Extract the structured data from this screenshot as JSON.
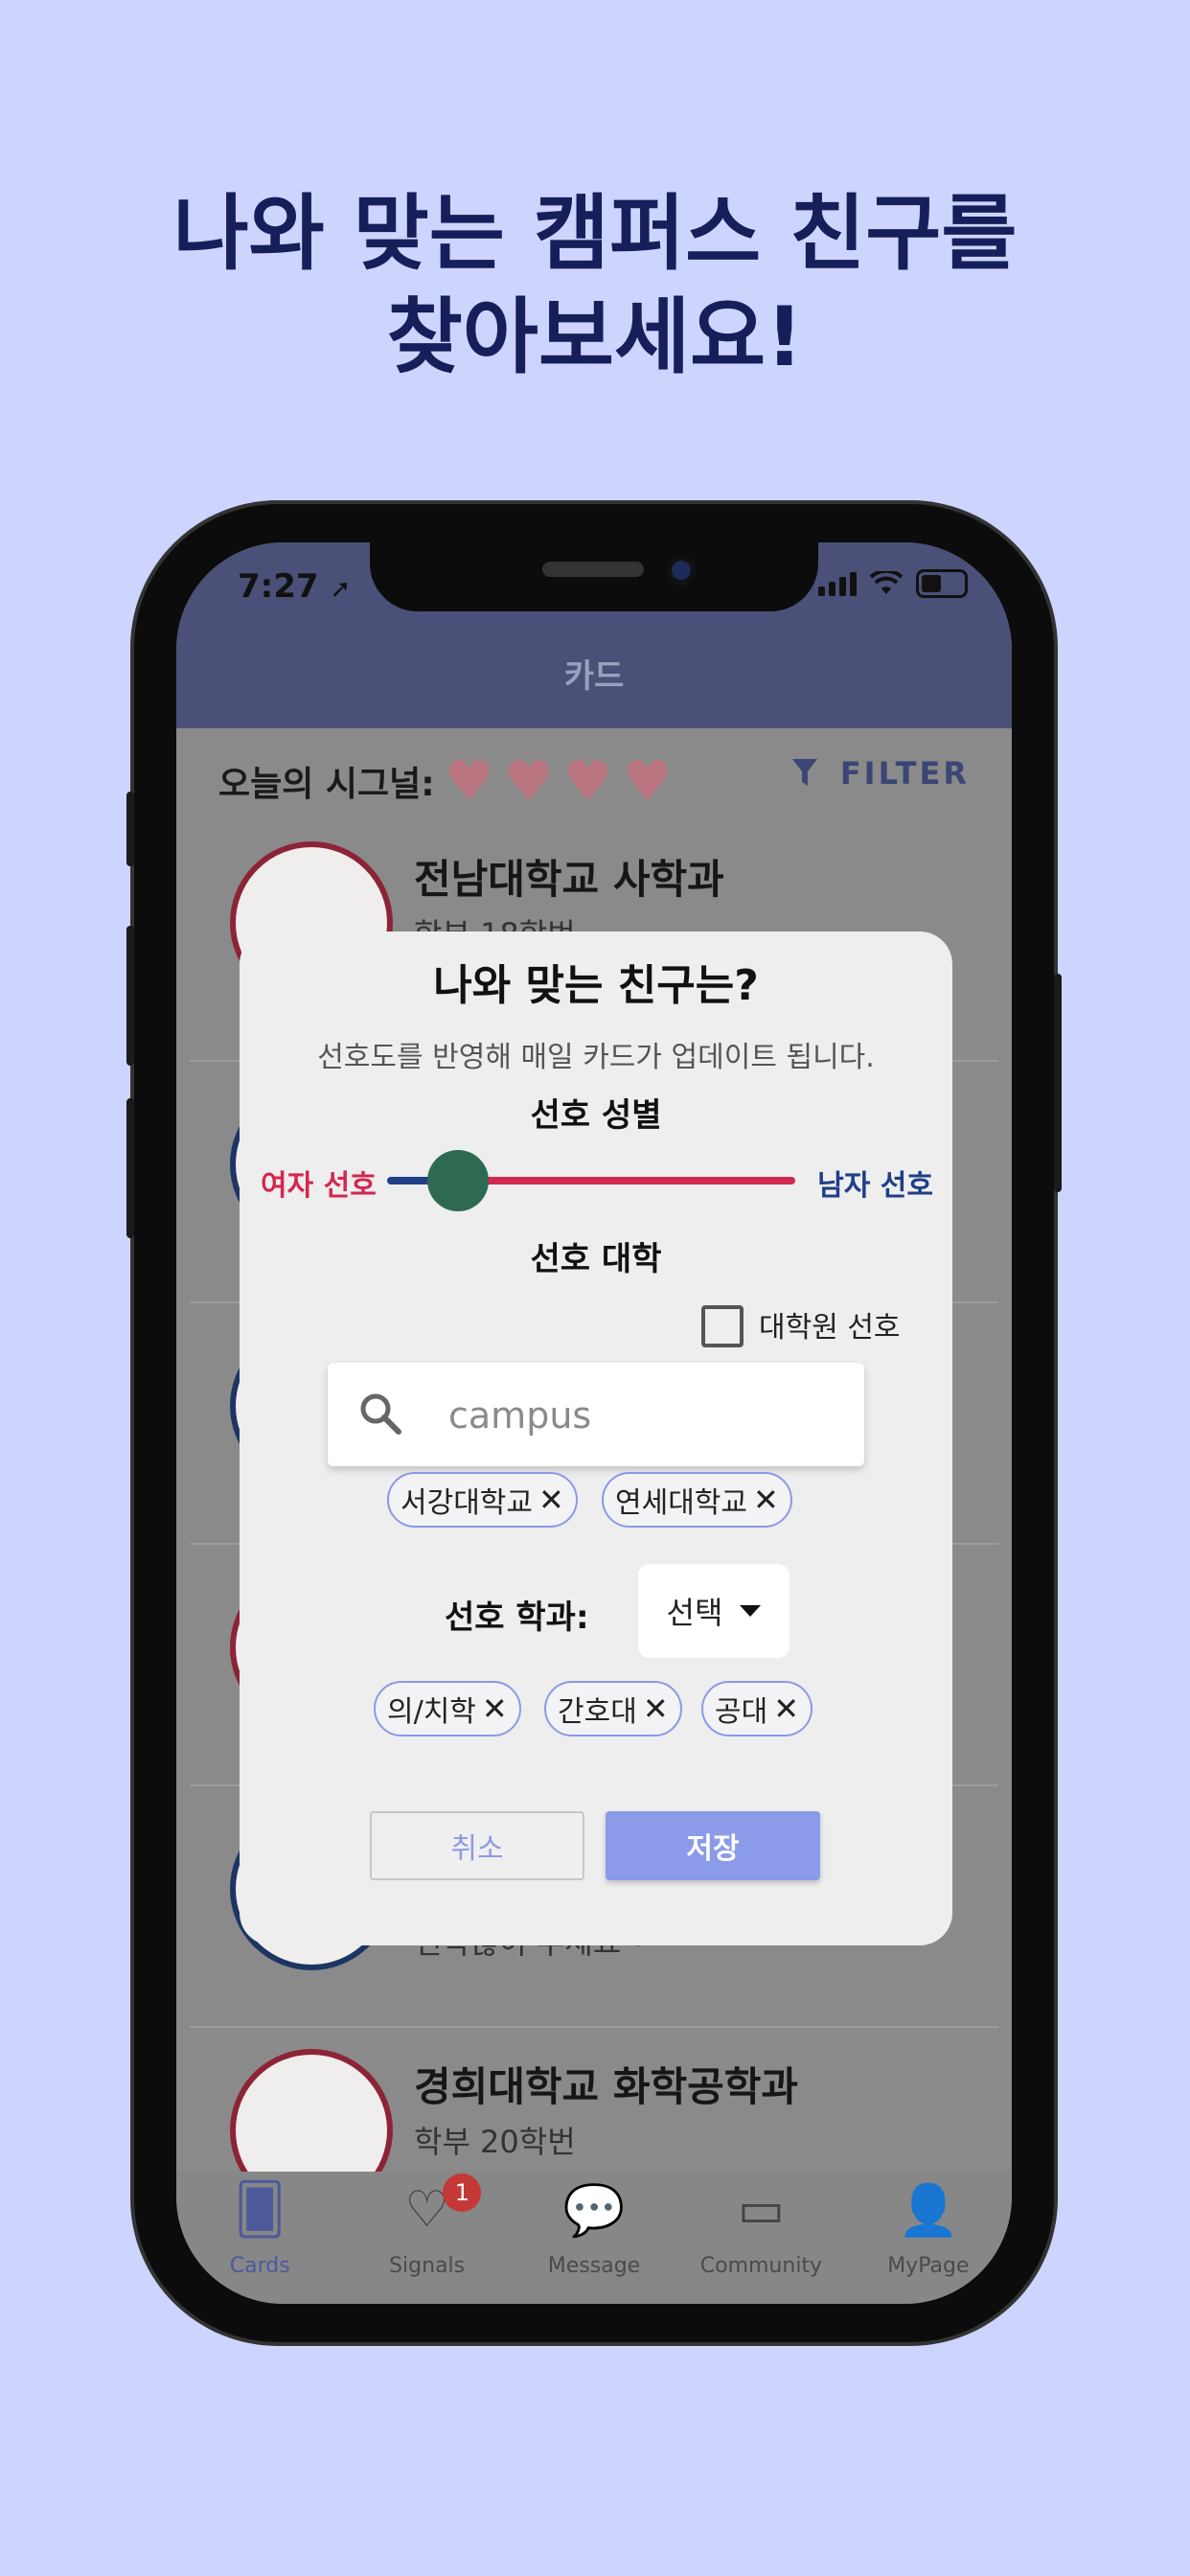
{
  "headline": {
    "line1": "나와 맞는 캠퍼스 친구를",
    "line2": "찾아보세요!"
  },
  "status_bar": {
    "time": "7:27"
  },
  "app_header": {
    "title": "카드"
  },
  "signal": {
    "label": "오늘의 시그널:",
    "hearts": 4,
    "filter_label": "FILTER"
  },
  "cards": [
    {
      "school": "전남대학교 사학과",
      "detail": "학부 18학번"
    },
    {
      "school": "",
      "detail": ""
    },
    {
      "school": "",
      "detail": ""
    },
    {
      "school": "",
      "detail": ""
    },
    {
      "school": "",
      "detail": "연락많이 주세요~"
    },
    {
      "school": "경희대학교 화학공학과",
      "detail": "학부 20학번"
    }
  ],
  "modal": {
    "title": "나와 맞는 친구는?",
    "description": "선호도를 반영해 매일 카드가 업데이트 됩니다.",
    "gender_section": "선호 성별",
    "female_label": "여자 선호",
    "male_label": "남자 선호",
    "gender_value": 0.17,
    "university_section": "선호 대학",
    "grad_checkbox_label": "대학원 선호",
    "grad_checked": false,
    "search_placeholder": "campus",
    "university_chips": [
      "서강대학교",
      "연세대학교"
    ],
    "department_label": "선호 학과:",
    "department_select": "선택",
    "department_chips": [
      "의/치학",
      "간호대",
      "공대"
    ],
    "cancel_label": "취소",
    "save_label": "저장"
  },
  "tabs": [
    {
      "label": "Cards",
      "icon": "cards-icon",
      "active": true
    },
    {
      "label": "Signals",
      "icon": "heartbeat-icon",
      "badge": "1"
    },
    {
      "label": "Message",
      "icon": "chat-bubble-icon"
    },
    {
      "label": "Community",
      "icon": "forum-icon"
    },
    {
      "label": "MyPage",
      "icon": "person-icon"
    }
  ],
  "colors": {
    "background": "#cdd5fe",
    "headline": "#161f5a",
    "accent": "#8b9ae9",
    "female": "#d2284f",
    "male": "#1f3f86",
    "slider_thumb": "#2e6a52"
  }
}
